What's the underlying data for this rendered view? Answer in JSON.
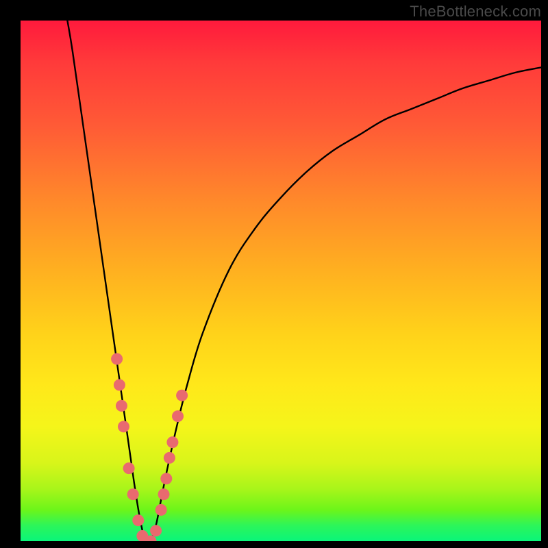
{
  "watermark": "TheBottleneck.com",
  "colors": {
    "frame": "#000000",
    "curve": "#000000",
    "marker_fill": "#e96a6f",
    "marker_stroke": "#c9595e",
    "grad_top": "#ff1a3c",
    "grad_bottom": "#0af57a"
  },
  "chart_data": {
    "type": "line",
    "title": "",
    "xlabel": "",
    "ylabel": "",
    "xlim": [
      0,
      100
    ],
    "ylim": [
      0,
      100
    ],
    "note": "x and y are relative percentages of the plot area. y=0 is bottom (green / no bottleneck), y=100 is top (red / severe bottleneck). The curve is an asymmetric V with its minimum near x≈24.",
    "series": [
      {
        "name": "bottleneck-curve",
        "x": [
          9,
          10,
          12,
          14,
          16,
          18,
          19,
          20,
          21,
          22,
          23,
          24,
          25,
          26,
          27,
          28,
          30,
          32,
          35,
          40,
          45,
          50,
          55,
          60,
          65,
          70,
          75,
          80,
          85,
          90,
          95,
          100
        ],
        "y": [
          100,
          94,
          80,
          66,
          52,
          38,
          31,
          24,
          17,
          10,
          4,
          0,
          0,
          3,
          8,
          13,
          22,
          30,
          40,
          52,
          60,
          66,
          71,
          75,
          78,
          81,
          83,
          85,
          87,
          88.5,
          90,
          91
        ]
      }
    ],
    "markers": {
      "name": "sample-points",
      "note": "Highlighted sample points (pink dots) clustered around the V minimum.",
      "points": [
        {
          "x": 18.5,
          "y": 35
        },
        {
          "x": 19.0,
          "y": 30
        },
        {
          "x": 19.4,
          "y": 26
        },
        {
          "x": 19.8,
          "y": 22
        },
        {
          "x": 20.8,
          "y": 14
        },
        {
          "x": 21.6,
          "y": 9
        },
        {
          "x": 22.6,
          "y": 4
        },
        {
          "x": 23.4,
          "y": 1
        },
        {
          "x": 24.2,
          "y": 0
        },
        {
          "x": 25.0,
          "y": 0
        },
        {
          "x": 26.0,
          "y": 2
        },
        {
          "x": 27.0,
          "y": 6
        },
        {
          "x": 27.5,
          "y": 9
        },
        {
          "x": 28.0,
          "y": 12
        },
        {
          "x": 28.6,
          "y": 16
        },
        {
          "x": 29.2,
          "y": 19
        },
        {
          "x": 30.2,
          "y": 24
        },
        {
          "x": 31.0,
          "y": 28
        }
      ]
    }
  }
}
